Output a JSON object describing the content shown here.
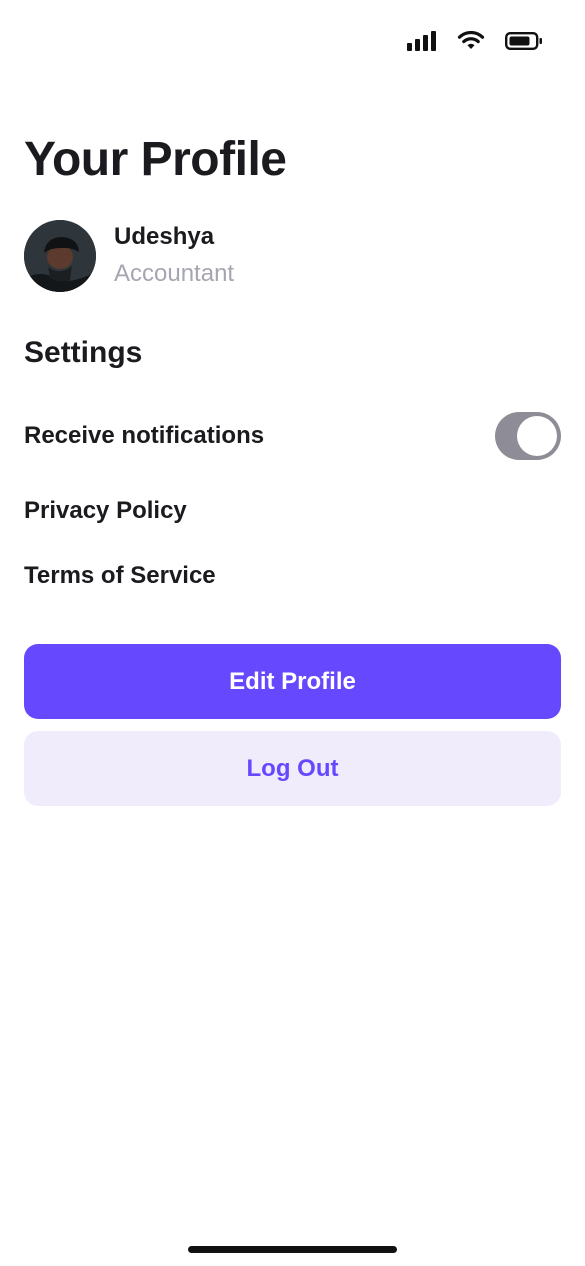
{
  "status_bar": {
    "icons": [
      "signal-icon",
      "wifi-icon",
      "battery-icon"
    ]
  },
  "page": {
    "title": "Your Profile"
  },
  "profile": {
    "name": "Udeshya",
    "role": "Accountant"
  },
  "settings": {
    "title": "Settings",
    "notifications_label": "Receive notifications",
    "notifications_enabled": true,
    "privacy_label": "Privacy Policy",
    "terms_label": "Terms of Service"
  },
  "actions": {
    "edit_label": "Edit Profile",
    "logout_label": "Log Out"
  },
  "colors": {
    "accent": "#6649ff",
    "secondary_bg": "#f0ecfc",
    "toggle_track": "#8e8c96",
    "muted_text": "#a6a6b3"
  }
}
